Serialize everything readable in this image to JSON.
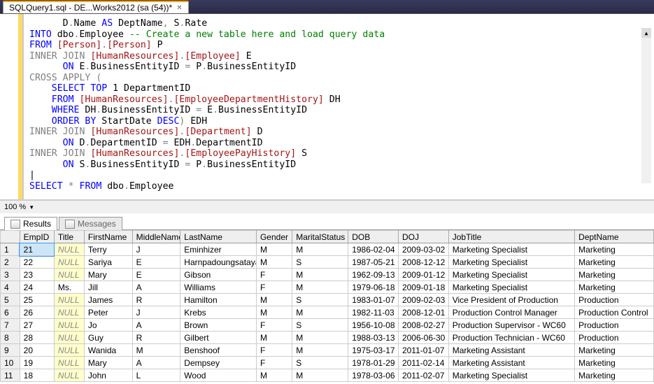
{
  "tab": {
    "title": "SQLQuery1.sql - DE...Works2012 (sa (54))*"
  },
  "zoom": {
    "level": "100 %"
  },
  "panels": {
    "results": "Results",
    "messages": "Messages"
  },
  "sql": {
    "l1a": "D",
    "l1b": "Name",
    "l1c": "AS",
    "l1d": " DeptName",
    "l1e": "S",
    "l1f": "Rate",
    "l2a": "INTO",
    "l2b": " dbo",
    "l2c": "Employee ",
    "l2d": "-- Create a new table here and load query data",
    "l3a": "FROM",
    "l3b": "[Person]",
    "l3c": "[Person]",
    "l3d": " P",
    "l4a": "INNER",
    "l4b": "JOIN",
    "l4c": "[HumanResources]",
    "l4d": "[Employee]",
    "l4e": " E",
    "l5a": "ON",
    "l5b": " E",
    "l5c": "BusinessEntityID ",
    "l5d": "=",
    "l5e": " P",
    "l5f": "BusinessEntityID",
    "l6a": "CROSS",
    "l6b": "APPLY",
    "l6c": "(",
    "l7a": "SELECT",
    "l7b": "TOP",
    "l7c": " 1 DepartmentID",
    "l8a": "FROM",
    "l8b": "[HumanResources]",
    "l8c": "[EmployeeDepartmentHistory]",
    "l8d": " DH",
    "l9a": "WHERE",
    "l9b": " DH",
    "l9c": "BusinessEntityID ",
    "l9d": "=",
    "l9e": " E",
    "l9f": "BusinessEntityID",
    "l10a": "ORDER",
    "l10b": "BY",
    "l10c": " StartDate ",
    "l10d": "DESC",
    "l10e": ")",
    "l10f": " EDH",
    "l11a": "INNER",
    "l11b": "JOIN",
    "l11c": "[HumanResources]",
    "l11d": "[Department]",
    "l11e": " D",
    "l12a": "ON",
    "l12b": " D",
    "l12c": "DepartmentID ",
    "l12d": "=",
    "l12e": " EDH",
    "l12f": "DepartmentID",
    "l13a": "INNER",
    "l13b": "JOIN",
    "l13c": "[HumanResources]",
    "l13d": "[EmployeePayHistory]",
    "l13e": " S",
    "l14a": "ON",
    "l14b": " S",
    "l14c": "BusinessEntityID ",
    "l14d": "=",
    "l14e": " P",
    "l14f": "BusinessEntityID",
    "l16a": "SELECT",
    "l16b": "*",
    "l16c": "FROM",
    "l16d": " dbo",
    "l16e": "Employee"
  },
  "cols": [
    "",
    "EmpID",
    "Title",
    "FirstName",
    "MiddleName",
    "LastName",
    "Gender",
    "MaritalStatus",
    "DOB",
    "DOJ",
    "JobTitle",
    "DeptName"
  ],
  "rows": [
    {
      "n": "1",
      "emp": "21",
      "title": null,
      "fn": "Terry",
      "mn": "J",
      "ln": "Eminhizer",
      "gen": "M",
      "ms": "M",
      "dob": "1986-02-04",
      "doj": "2009-03-02",
      "jt": "Marketing Specialist",
      "dept": "Marketing"
    },
    {
      "n": "2",
      "emp": "22",
      "title": null,
      "fn": "Sariya",
      "mn": "E",
      "ln": "Harnpadoungsataya",
      "gen": "M",
      "ms": "S",
      "dob": "1987-05-21",
      "doj": "2008-12-12",
      "jt": "Marketing Specialist",
      "dept": "Marketing"
    },
    {
      "n": "3",
      "emp": "23",
      "title": null,
      "fn": "Mary",
      "mn": "E",
      "ln": "Gibson",
      "gen": "F",
      "ms": "M",
      "dob": "1962-09-13",
      "doj": "2009-01-12",
      "jt": "Marketing Specialist",
      "dept": "Marketing"
    },
    {
      "n": "4",
      "emp": "24",
      "title": "Ms.",
      "fn": "Jill",
      "mn": "A",
      "ln": "Williams",
      "gen": "F",
      "ms": "M",
      "dob": "1979-06-18",
      "doj": "2009-01-18",
      "jt": "Marketing Specialist",
      "dept": "Marketing"
    },
    {
      "n": "5",
      "emp": "25",
      "title": null,
      "fn": "James",
      "mn": "R",
      "ln": "Hamilton",
      "gen": "M",
      "ms": "S",
      "dob": "1983-01-07",
      "doj": "2009-02-03",
      "jt": "Vice President of Production",
      "dept": "Production"
    },
    {
      "n": "6",
      "emp": "26",
      "title": null,
      "fn": "Peter",
      "mn": "J",
      "ln": "Krebs",
      "gen": "M",
      "ms": "M",
      "dob": "1982-11-03",
      "doj": "2008-12-01",
      "jt": "Production Control Manager",
      "dept": "Production Control"
    },
    {
      "n": "7",
      "emp": "27",
      "title": null,
      "fn": "Jo",
      "mn": "A",
      "ln": "Brown",
      "gen": "F",
      "ms": "S",
      "dob": "1956-10-08",
      "doj": "2008-02-27",
      "jt": "Production Supervisor - WC60",
      "dept": "Production"
    },
    {
      "n": "8",
      "emp": "28",
      "title": null,
      "fn": "Guy",
      "mn": "R",
      "ln": "Gilbert",
      "gen": "M",
      "ms": "M",
      "dob": "1988-03-13",
      "doj": "2006-06-30",
      "jt": "Production Technician - WC60",
      "dept": "Production"
    },
    {
      "n": "9",
      "emp": "20",
      "title": null,
      "fn": "Wanida",
      "mn": "M",
      "ln": "Benshoof",
      "gen": "F",
      "ms": "M",
      "dob": "1975-03-17",
      "doj": "2011-01-07",
      "jt": "Marketing Assistant",
      "dept": "Marketing"
    },
    {
      "n": "10",
      "emp": "19",
      "title": null,
      "fn": "Mary",
      "mn": "A",
      "ln": "Dempsey",
      "gen": "F",
      "ms": "S",
      "dob": "1978-01-29",
      "doj": "2011-02-14",
      "jt": "Marketing Assistant",
      "dept": "Marketing"
    },
    {
      "n": "11",
      "emp": "18",
      "title": null,
      "fn": "John",
      "mn": "L",
      "ln": "Wood",
      "gen": "M",
      "ms": "M",
      "dob": "1978-03-06",
      "doj": "2011-02-07",
      "jt": "Marketing Specialist",
      "dept": "Marketing"
    }
  ],
  "null_text": "NULL"
}
